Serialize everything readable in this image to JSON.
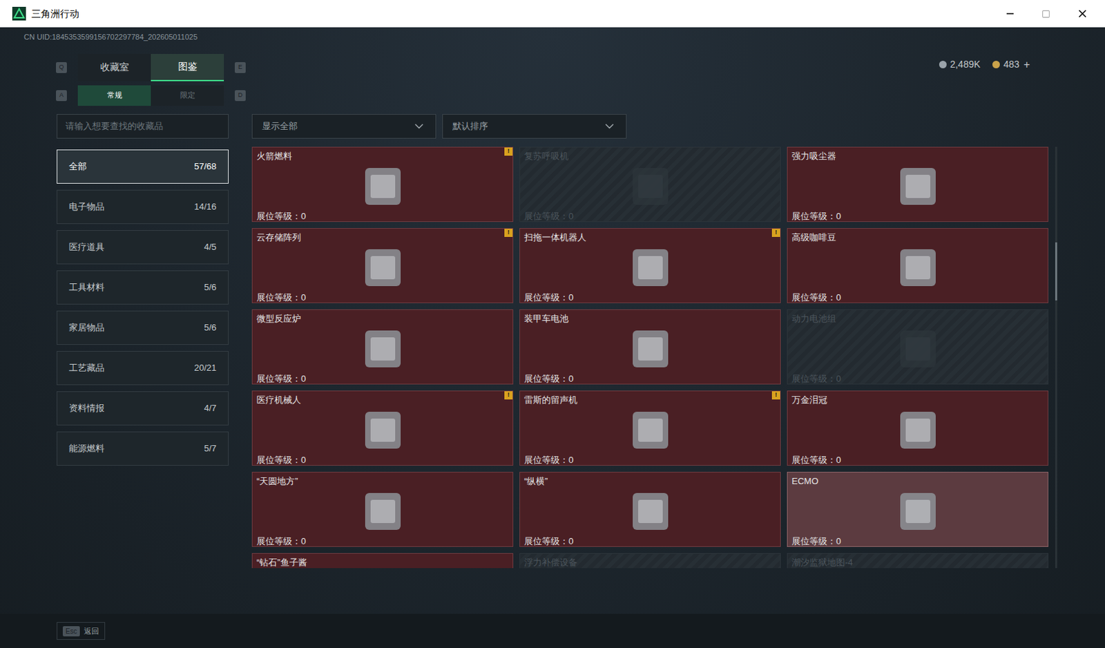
{
  "window": {
    "title": "三角洲行动",
    "uid": "CN UID:1845353599156702297784_202605011025"
  },
  "currency": [
    {
      "value": "2,489K",
      "color": "#9aa3aa"
    },
    {
      "value": "483",
      "color": "#c9a24a"
    }
  ],
  "currency_add": "+",
  "tabs": {
    "prev_key": "Q",
    "next_key": "E",
    "items": [
      {
        "label": "收藏室",
        "selected": false
      },
      {
        "label": "图鉴",
        "selected": true
      }
    ]
  },
  "subtabs": {
    "prev_key": "A",
    "next_key": "D",
    "items": [
      {
        "label": "常规",
        "selected": true
      },
      {
        "label": "限定",
        "selected": false
      }
    ]
  },
  "search": {
    "placeholder": "请输入想要查找的收藏品"
  },
  "filters": [
    {
      "label": "显示全部"
    },
    {
      "label": "默认排序"
    }
  ],
  "sidebar": {
    "items": [
      {
        "label": "全部",
        "count": "57/68",
        "selected": true
      },
      {
        "label": "电子物品",
        "count": "14/16",
        "selected": false
      },
      {
        "label": "医疗道具",
        "count": "4/5",
        "selected": false
      },
      {
        "label": "工具材料",
        "count": "5/6",
        "selected": false
      },
      {
        "label": "家居物品",
        "count": "5/6",
        "selected": false
      },
      {
        "label": "工艺藏品",
        "count": "20/21",
        "selected": false
      },
      {
        "label": "资料情报",
        "count": "4/7",
        "selected": false
      },
      {
        "label": "能源燃料",
        "count": "5/7",
        "selected": false
      }
    ]
  },
  "items": [
    {
      "name": "火箭燃料",
      "level": "展位等级：0",
      "collected": true,
      "alert": true,
      "highlighted": false
    },
    {
      "name": "复苏呼吸机",
      "level": "展位等级：0",
      "collected": false,
      "alert": false,
      "highlighted": false
    },
    {
      "name": "强力吸尘器",
      "level": "展位等级：0",
      "collected": true,
      "alert": false,
      "highlighted": false
    },
    {
      "name": "云存储阵列",
      "level": "展位等级：0",
      "collected": true,
      "alert": true,
      "highlighted": false
    },
    {
      "name": "扫拖一体机器人",
      "level": "展位等级：0",
      "collected": true,
      "alert": true,
      "highlighted": false
    },
    {
      "name": "高级咖啡豆",
      "level": "展位等级：0",
      "collected": true,
      "alert": false,
      "highlighted": false
    },
    {
      "name": "微型反应炉",
      "level": "展位等级：0",
      "collected": true,
      "alert": false,
      "highlighted": false
    },
    {
      "name": "装甲车电池",
      "level": "展位等级：0",
      "collected": true,
      "alert": false,
      "highlighted": false
    },
    {
      "name": "动力电池组",
      "level": "展位等级：0",
      "collected": false,
      "alert": false,
      "highlighted": false
    },
    {
      "name": "医疗机械人",
      "level": "展位等级：0",
      "collected": true,
      "alert": true,
      "highlighted": false
    },
    {
      "name": "雷斯的留声机",
      "level": "展位等级：0",
      "collected": true,
      "alert": true,
      "highlighted": false
    },
    {
      "name": "万金泪冠",
      "level": "展位等级：0",
      "collected": true,
      "alert": false,
      "highlighted": false
    },
    {
      "name": "“天圆地方”",
      "level": "展位等级：0",
      "collected": true,
      "alert": false,
      "highlighted": false
    },
    {
      "name": "“纵横”",
      "level": "展位等级：0",
      "collected": true,
      "alert": false,
      "highlighted": false
    },
    {
      "name": "ECMO",
      "level": "展位等级：0",
      "collected": true,
      "alert": false,
      "highlighted": true
    },
    {
      "name": "“钻石”鱼子酱",
      "level": "",
      "collected": true,
      "alert": false,
      "highlighted": false
    },
    {
      "name": "浮力补偿设备",
      "level": "",
      "collected": false,
      "alert": false,
      "highlighted": false
    },
    {
      "name": "潮汐监狱地图-4",
      "level": "",
      "collected": false,
      "alert": false,
      "highlighted": false
    }
  ],
  "alert_mark": "!",
  "footer": {
    "key": "Esc",
    "label": "返回"
  }
}
